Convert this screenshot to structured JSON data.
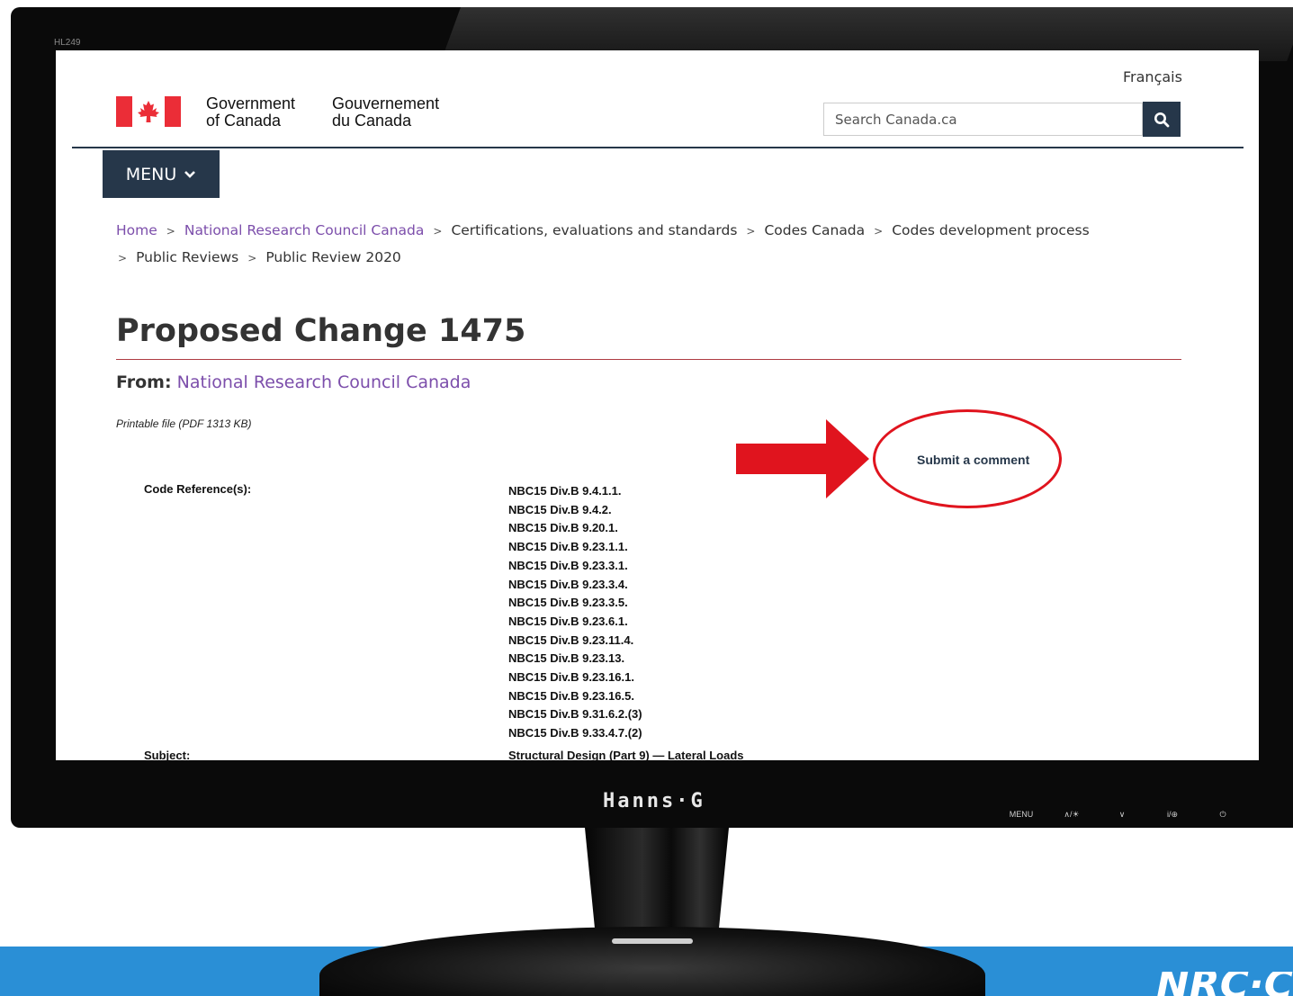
{
  "monitor": {
    "model_label": "HL249",
    "brand": "Hanns·G",
    "buttons": [
      "MENU",
      "∧/☀",
      "∨",
      "i/⊕",
      "⏻"
    ]
  },
  "corner_logo": "NRC·C",
  "header": {
    "language_link": "Français",
    "gov_en_line1": "Government",
    "gov_en_line2": "of Canada",
    "gov_fr_line1": "Gouvernement",
    "gov_fr_line2": "du Canada",
    "search_placeholder": "Search Canada.ca",
    "menu_label": "MENU"
  },
  "breadcrumb": {
    "items": [
      "Home",
      "National Research Council Canada",
      "Certifications, evaluations and standards",
      "Codes Canada",
      "Codes development process",
      "Public Reviews",
      "Public Review 2020"
    ],
    "separator": ">"
  },
  "page": {
    "title": "Proposed Change 1475",
    "from_label": "From:",
    "from_org": "National Research Council Canada",
    "printable_file": "Printable file (PDF 1313 KB)",
    "submit_comment": "Submit a comment",
    "code_reference_label": "Code Reference(s):",
    "code_references": [
      "NBC15 Div.B 9.4.1.1.",
      "NBC15 Div.B 9.4.2.",
      "NBC15 Div.B 9.20.1.",
      "NBC15 Div.B 9.23.1.1.",
      "NBC15 Div.B 9.23.3.1.",
      "NBC15 Div.B 9.23.3.4.",
      "NBC15 Div.B 9.23.3.5.",
      "NBC15 Div.B 9.23.6.1.",
      "NBC15 Div.B 9.23.11.4.",
      "NBC15 Div.B 9.23.13.",
      "NBC15 Div.B 9.23.16.1.",
      "NBC15 Div.B 9.23.16.5.",
      "NBC15 Div.B 9.31.6.2.(3)",
      "NBC15 Div.B 9.33.4.7.(2)"
    ],
    "subject_label": "Subject:",
    "subject_value": "Structural Design (Part 9) — Lateral Loads"
  },
  "colors": {
    "gc_navy": "#26374a",
    "link_purple": "#7c4eab",
    "title_rule": "#af3c43",
    "annotation_red": "#e0141e",
    "band_blue": "#2a8fd6"
  },
  "icons": {
    "search": "magnifier-icon",
    "menu_chevron": "chevron-down-icon",
    "flag": "canada-flag-icon"
  }
}
